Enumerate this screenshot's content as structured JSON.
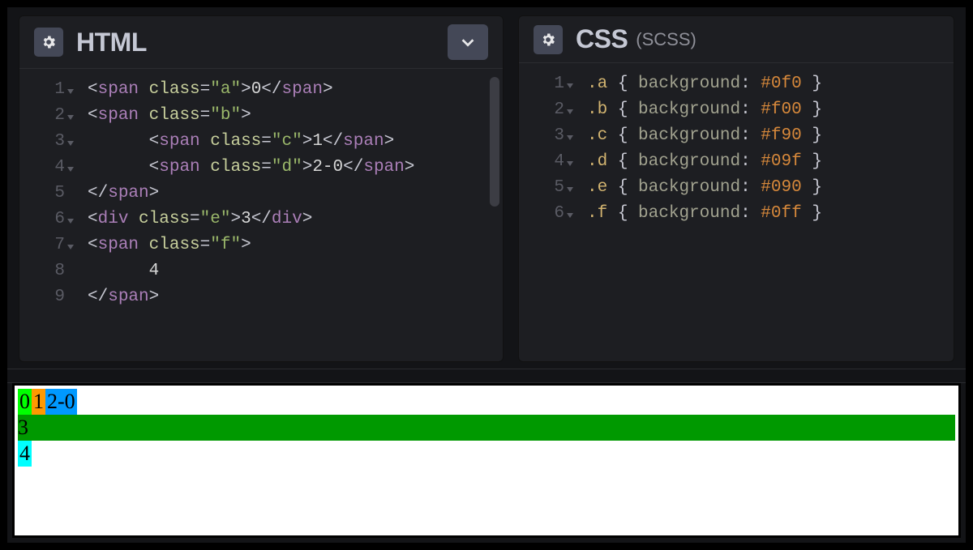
{
  "panes": {
    "html": {
      "title": "HTML",
      "lines": [
        1,
        2,
        3,
        4,
        5,
        6,
        7,
        8,
        9
      ],
      "fold": [
        true,
        true,
        true,
        true,
        false,
        true,
        true,
        false,
        false
      ],
      "code": {
        "l1": {
          "tag": "span",
          "attr": "class",
          "val": "\"a\"",
          "txt": "0",
          "close": "span"
        },
        "l2": {
          "tag": "span",
          "attr": "class",
          "val": "\"b\""
        },
        "l3": {
          "indent": "      ",
          "tag": "span",
          "attr": "class",
          "val": "\"c\"",
          "txt": "1",
          "close": "span"
        },
        "l4": {
          "indent": "      ",
          "tag": "span",
          "attr": "class",
          "val": "\"d\"",
          "txt": "2-0",
          "close": "span"
        },
        "l5": {
          "close": "span"
        },
        "l6": {
          "tag": "div",
          "attr": "class",
          "val": "\"e\"",
          "txt": "3",
          "close": "div"
        },
        "l7": {
          "tag": "span",
          "attr": "class",
          "val": "\"f\""
        },
        "l8": {
          "txt": "      4"
        },
        "l9": {
          "close": "span"
        }
      }
    },
    "css": {
      "title": "CSS",
      "subtitle": "(SCSS)",
      "lines": [
        1,
        2,
        3,
        4,
        5,
        6
      ],
      "rules": [
        {
          "sel": ".a",
          "prop": "background",
          "val": "#0f0"
        },
        {
          "sel": ".b",
          "prop": "background",
          "val": "#f00"
        },
        {
          "sel": ".c",
          "prop": "background",
          "val": "#f90"
        },
        {
          "sel": ".d",
          "prop": "background",
          "val": "#09f"
        },
        {
          "sel": ".e",
          "prop": "background",
          "val": "#090"
        },
        {
          "sel": ".f",
          "prop": "background",
          "val": "#0ff"
        }
      ]
    }
  },
  "output": {
    "a": "0",
    "c": "1",
    "d": "2-0",
    "e": "3",
    "f": "4"
  }
}
